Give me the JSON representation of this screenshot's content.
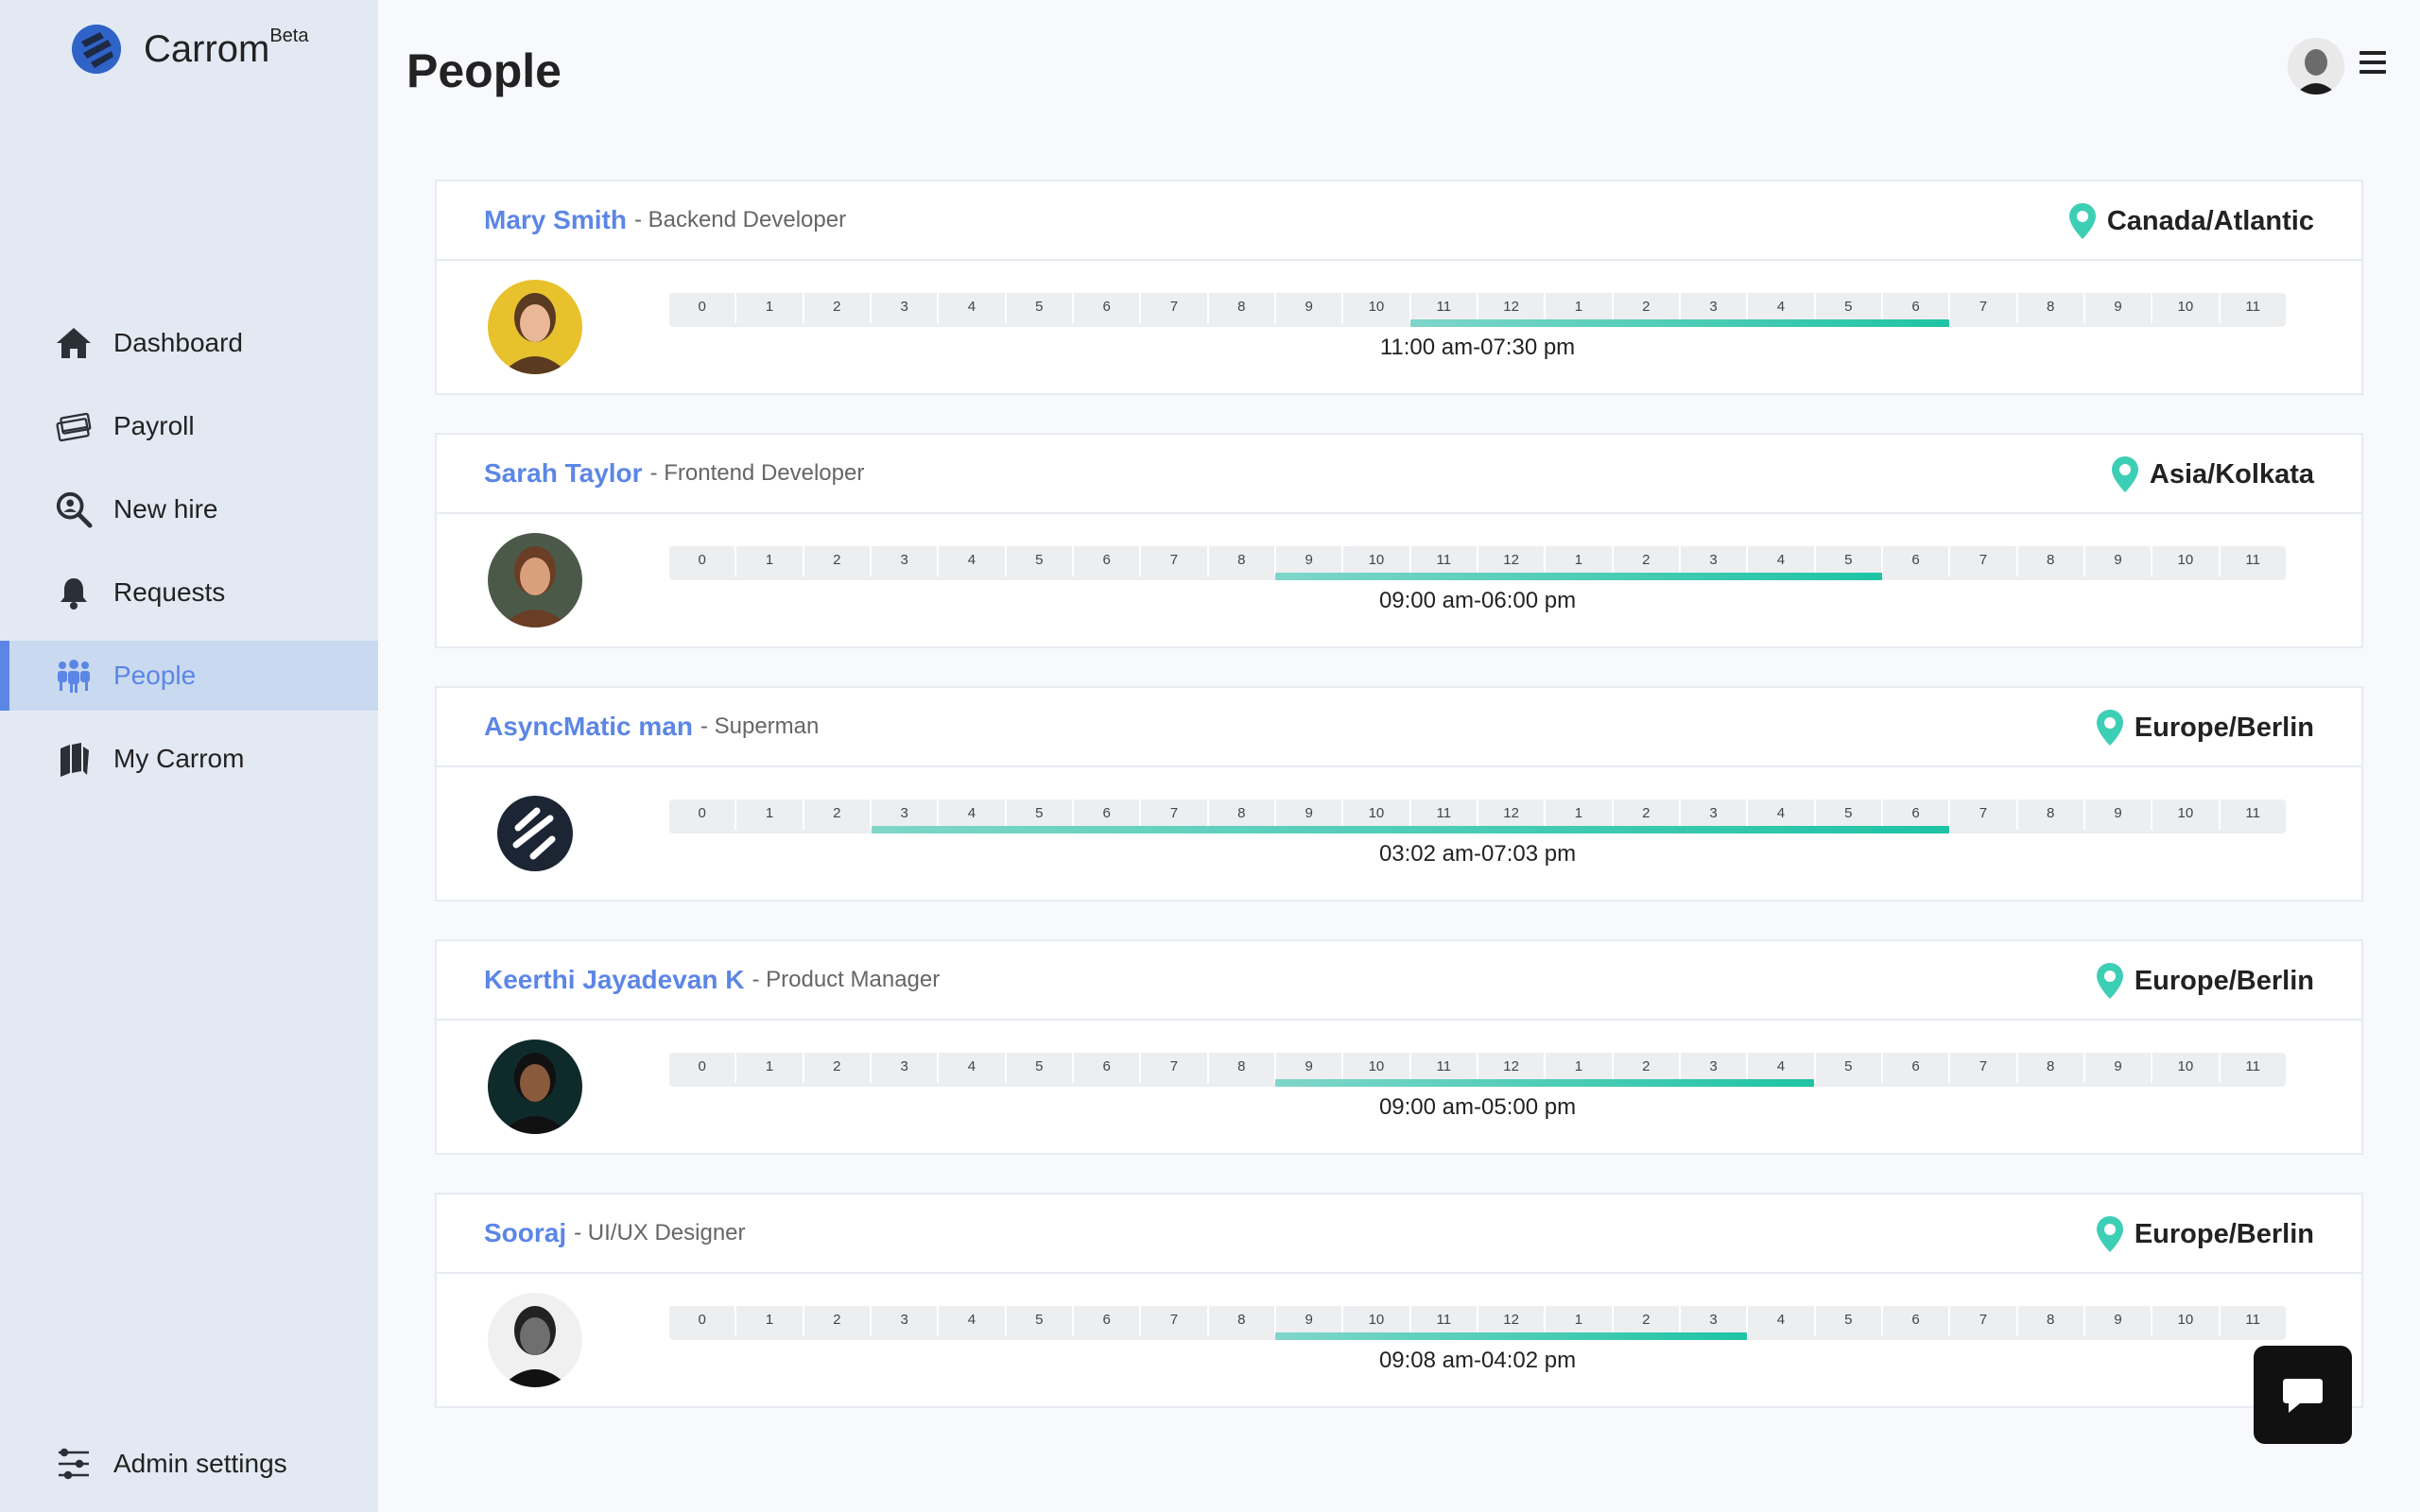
{
  "brand": {
    "name": "Carrom",
    "badge": "Beta"
  },
  "nav": {
    "items": [
      {
        "label": "Dashboard",
        "icon": "home-icon"
      },
      {
        "label": "Payroll",
        "icon": "payroll-icon"
      },
      {
        "label": "New hire",
        "icon": "search-person-icon"
      },
      {
        "label": "Requests",
        "icon": "bell-icon"
      },
      {
        "label": "People",
        "icon": "people-icon",
        "active": true
      },
      {
        "label": "My Carrom",
        "icon": "books-icon"
      }
    ],
    "bottom": {
      "label": "Admin settings",
      "icon": "sliders-icon"
    }
  },
  "header": {
    "title": "People"
  },
  "hours": [
    "0",
    "1",
    "2",
    "3",
    "4",
    "5",
    "6",
    "7",
    "8",
    "9",
    "10",
    "11",
    "12",
    "1",
    "2",
    "3",
    "4",
    "5",
    "6",
    "7",
    "8",
    "9",
    "10",
    "11"
  ],
  "people": [
    {
      "name": "Mary Smith",
      "role": "- Backend Developer",
      "location": "Canada/Atlantic",
      "time_range": "11:00 am-07:30 pm",
      "start_hour": 11.0,
      "end_hour": 19.0
    },
    {
      "name": "Sarah Taylor",
      "role": "- Frontend Developer",
      "location": "Asia/Kolkata",
      "time_range": "09:00 am-06:00 pm",
      "start_hour": 9.0,
      "end_hour": 18.0
    },
    {
      "name": "AsyncMatic man",
      "role": "- Superman",
      "location": "Europe/Berlin",
      "time_range": "03:02 am-07:03 pm",
      "start_hour": 3.0,
      "end_hour": 19.0
    },
    {
      "name": "Keerthi Jayadevan K",
      "role": "- Product Manager",
      "location": "Europe/Berlin",
      "time_range": "09:00 am-05:00 pm",
      "start_hour": 9.0,
      "end_hour": 17.0
    },
    {
      "name": "Sooraj",
      "role": "- UI/UX Designer",
      "location": "Europe/Berlin",
      "time_range": "09:08 am-04:02 pm",
      "start_hour": 9.0,
      "end_hour": 16.0
    }
  ],
  "colors": {
    "accent": "#5c86e6",
    "bar_start": "#7fd6c9",
    "bar_end": "#1ec4a4",
    "pin": "#3dcfb5"
  }
}
